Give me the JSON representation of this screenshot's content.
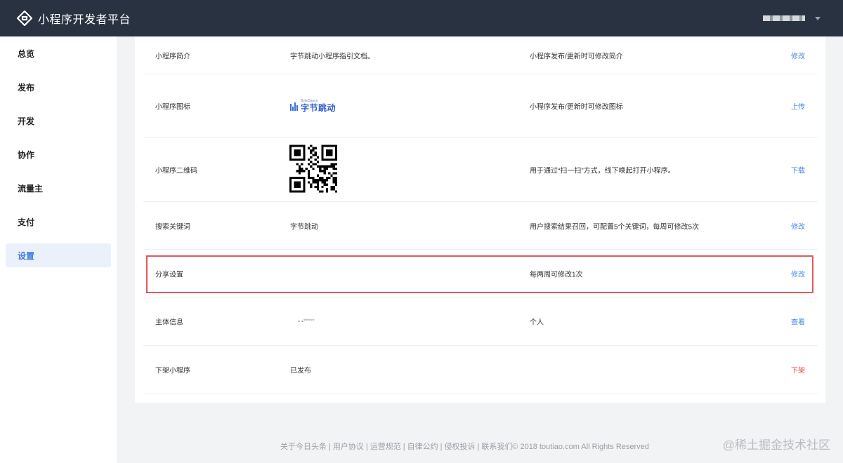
{
  "header": {
    "title": "小程序开发者平台",
    "logo_icon": "platform-logo-icon",
    "user_icon": "chevron-down-icon"
  },
  "sidebar": {
    "items": [
      {
        "label": "总览",
        "active": false
      },
      {
        "label": "发布",
        "active": false
      },
      {
        "label": "开发",
        "active": false
      },
      {
        "label": "协作",
        "active": false
      },
      {
        "label": "流量主",
        "active": false
      },
      {
        "label": "支付",
        "active": false
      },
      {
        "label": "设置",
        "active": true
      }
    ]
  },
  "settings": {
    "rows": [
      {
        "label": "小程序简介",
        "value": "字节跳动小程序指引文档。",
        "desc": "小程序发布/更新时可修改简介",
        "action": "修改"
      },
      {
        "label": "小程序图标",
        "value": "",
        "desc": "小程序发布/更新时可修改图标",
        "action": "上传"
      },
      {
        "label": "小程序二维码",
        "value": "",
        "desc": "用于通过“扫一扫”方式，线下唤起打开小程序。",
        "action": "下载"
      },
      {
        "label": "搜索关键词",
        "value": "字节跳动",
        "desc": "用户搜索结果召回，可配置5个关键词，每周可修改5次",
        "action": "修改"
      },
      {
        "label": "分享设置",
        "value": "",
        "desc": "每两周可修改1次",
        "action": "修改"
      },
      {
        "label": "主体信息",
        "value": "▪ ▪*****",
        "desc": "个人",
        "action": "查看"
      },
      {
        "label": "下架小程序",
        "value": "已发布",
        "desc": "",
        "action": "下架"
      }
    ],
    "icon_brand": {
      "small": "ByteDance",
      "big": "字节跳动"
    }
  },
  "footer": {
    "links": [
      "关于今日头条",
      "用户协议",
      "运营规范",
      "自律公约",
      "侵权投诉",
      "联系我们"
    ],
    "copyright": "© 2018 toutiao.com All Rights Reserved"
  },
  "watermark": "@稀土掘金技术社区",
  "colors": {
    "topbar": "#293240",
    "accent": "#4a86e8",
    "danger": "#e64545",
    "highlight": "#e05a5a"
  }
}
